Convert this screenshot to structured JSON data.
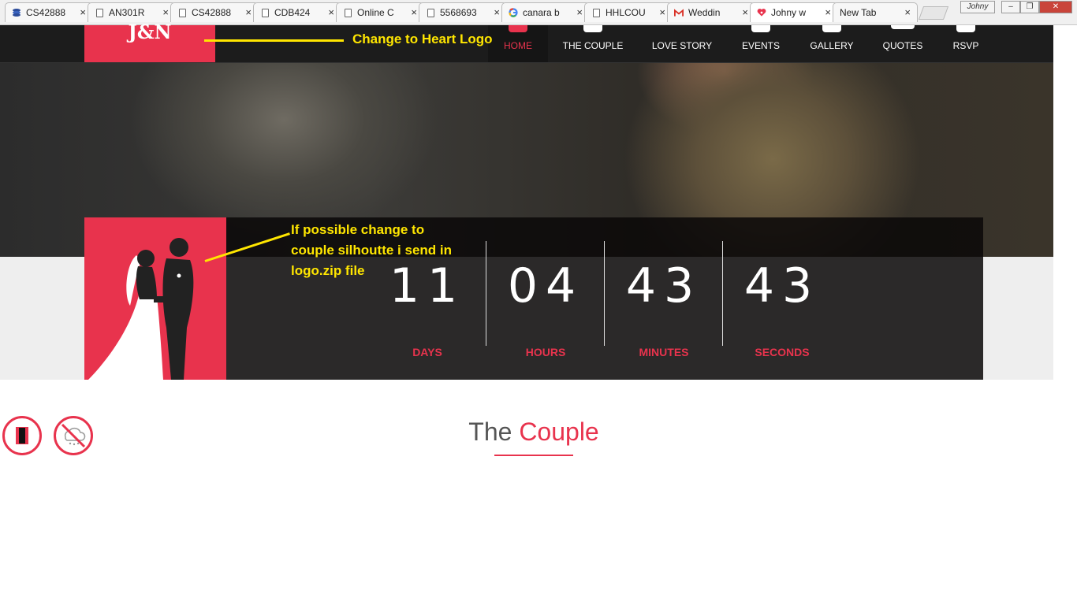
{
  "browser": {
    "tabs": [
      {
        "label": "CS42888",
        "icon": "stack-icon"
      },
      {
        "label": "AN301R",
        "icon": "document-icon"
      },
      {
        "label": "CS42888",
        "icon": "document-icon"
      },
      {
        "label": "CDB424",
        "icon": "document-icon"
      },
      {
        "label": "Online C",
        "icon": "document-icon"
      },
      {
        "label": "5568693",
        "icon": "document-icon"
      },
      {
        "label": "canara b",
        "icon": "google-icon"
      },
      {
        "label": "HHLCOU",
        "icon": "document-icon"
      },
      {
        "label": "Weddin",
        "icon": "gmail-icon"
      },
      {
        "label": "Johny w",
        "icon": "heart-icon",
        "active": true
      },
      {
        "label": "New Tab",
        "icon": ""
      }
    ],
    "close_glyph": "×",
    "profile_name": "Johny",
    "window_controls": {
      "minimize": "–",
      "restore": "❐",
      "close": "✕"
    }
  },
  "site": {
    "logo": "J&N",
    "nav": [
      {
        "label": "HOME",
        "active": true
      },
      {
        "label": "THE COUPLE"
      },
      {
        "label": "LOVE STORY"
      },
      {
        "label": "EVENTS"
      },
      {
        "label": "GALLERY"
      },
      {
        "label": "QUOTES"
      },
      {
        "label": "RSVP"
      }
    ]
  },
  "countdown": [
    {
      "value": "11",
      "label": "DAYS"
    },
    {
      "value": "04",
      "label": "HOURS"
    },
    {
      "value": "43",
      "label": "MINUTES"
    },
    {
      "value": "43",
      "label": "SECONDS"
    }
  ],
  "annotations": {
    "logo_note": "Change to Heart Logo",
    "silhouette_note_lines": [
      "If possible change to",
      "couple silhoutte i send in",
      "logo.zip file"
    ]
  },
  "section": {
    "title_plain": "The",
    "title_highlight": "Couple"
  },
  "colors": {
    "accent": "#e8334d",
    "annotation": "#ffe600",
    "nav_bg": "#1c1c1c"
  }
}
